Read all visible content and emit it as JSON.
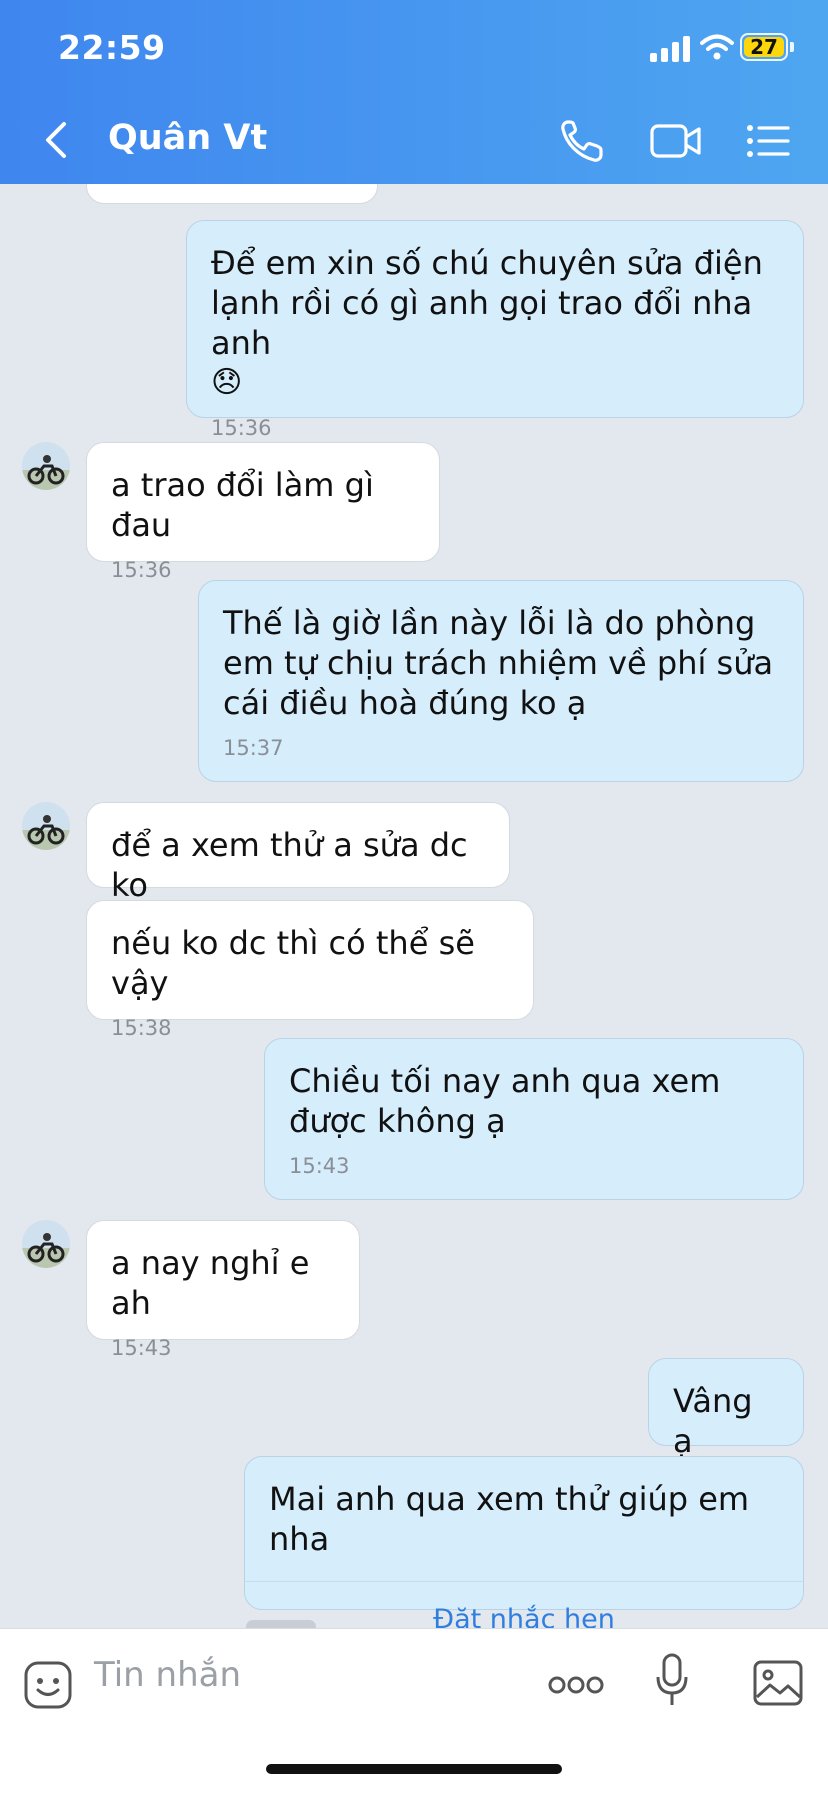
{
  "status_bar": {
    "time": "22:59",
    "battery": "27"
  },
  "header": {
    "name": "Quân Vt"
  },
  "messages": [
    {
      "side": "out",
      "text": "Để em xin số chú chuyên sửa điện lạnh rồi có gì anh gọi trao đổi nha anh",
      "emoji": "😞",
      "time": "15:36"
    },
    {
      "side": "in",
      "text": "a trao đổi làm gì đau",
      "time": "15:36"
    },
    {
      "side": "out",
      "text": "Thế là giờ lần này lỗi là do phòng em tự chịu trách nhiệm về phí sửa cái điều hoà đúng ko ạ",
      "time": "15:37"
    },
    {
      "side": "in",
      "text": "để a xem thử a sửa dc ko"
    },
    {
      "side": "in",
      "text": "nếu ko dc thì có thể sẽ vậy",
      "time": "15:38"
    },
    {
      "side": "out",
      "text": "Chiều tối nay anh qua xem được không ạ",
      "time": "15:43"
    },
    {
      "side": "in",
      "text": "a nay nghỉ e ah",
      "time": "15:43"
    },
    {
      "side": "out",
      "text": "Vâng ạ"
    },
    {
      "side": "out",
      "text": "Mai anh qua xem thử giúp em nha",
      "action": "Đặt nhắc hẹn"
    }
  ],
  "input": {
    "placeholder": "Tin nhắn"
  }
}
